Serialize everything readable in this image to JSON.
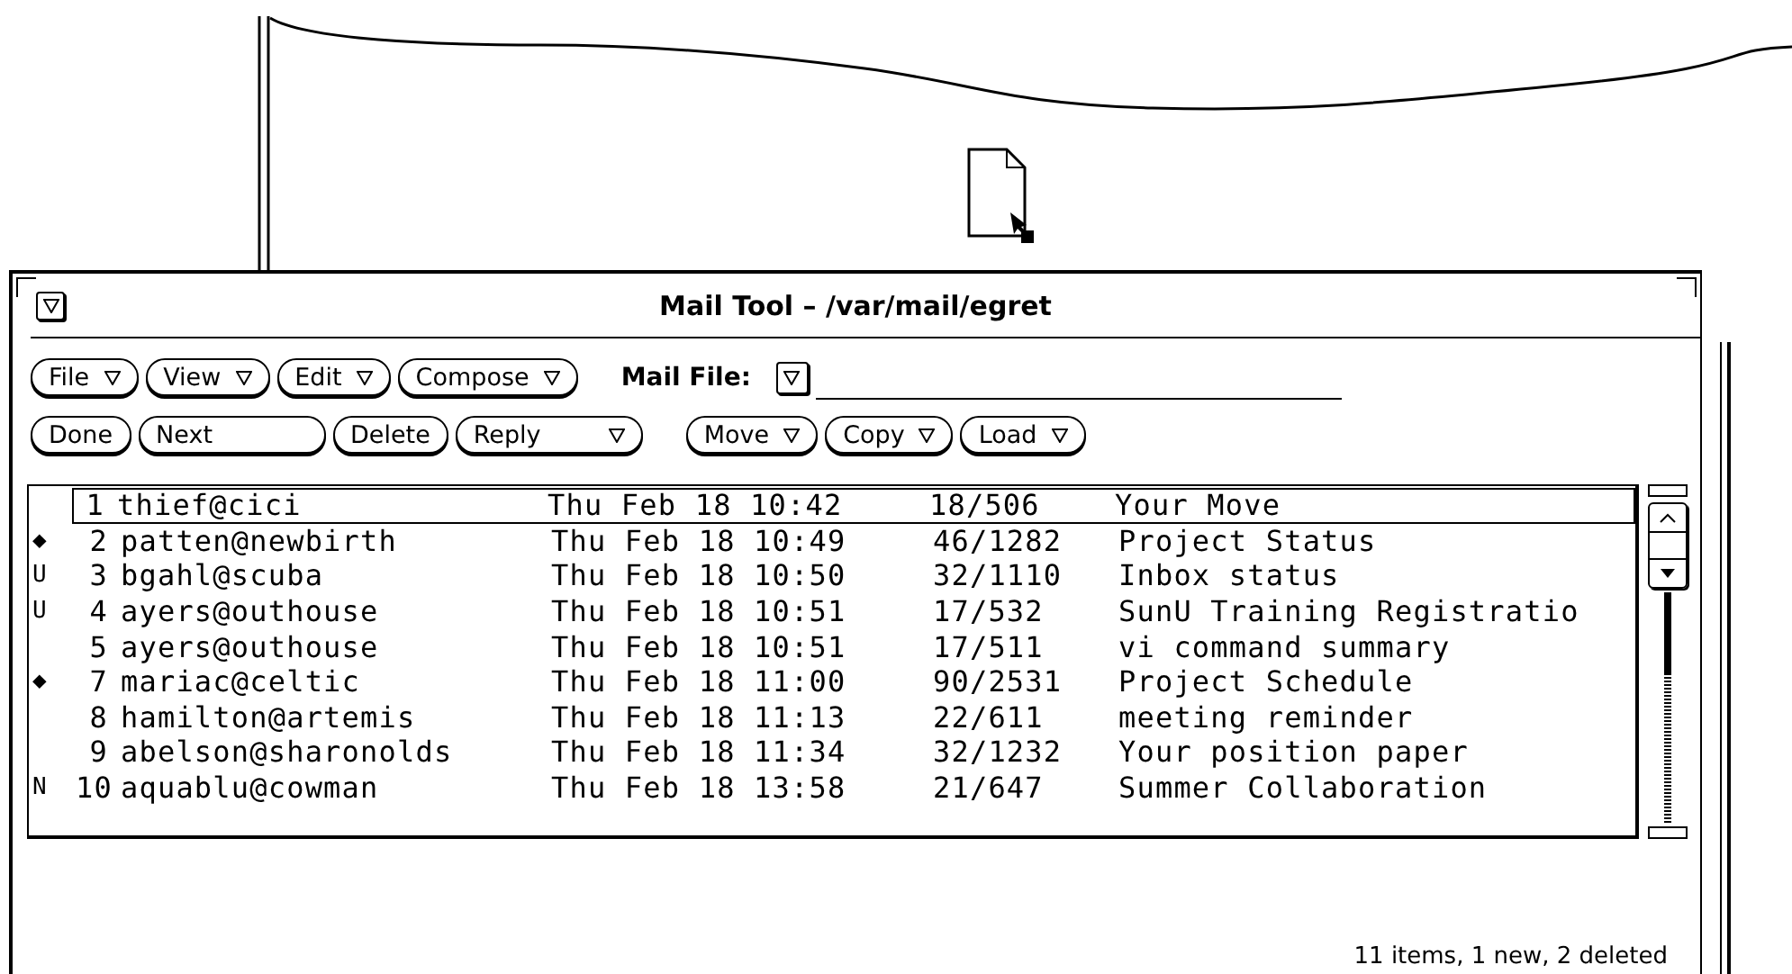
{
  "window": {
    "title": "Mail Tool  – /var/mail/egret"
  },
  "menu_buttons": [
    {
      "label": "File",
      "has_menu": true
    },
    {
      "label": "View",
      "has_menu": true
    },
    {
      "label": "Edit",
      "has_menu": true
    },
    {
      "label": "Compose",
      "has_menu": true
    }
  ],
  "mail_file": {
    "label": "Mail File:"
  },
  "action_buttons": [
    {
      "label": "Done",
      "has_menu": false,
      "wide": false
    },
    {
      "label": "Next",
      "has_menu": false,
      "wide": true
    },
    {
      "label": "Delete",
      "has_menu": false,
      "wide": false
    },
    {
      "label": "Reply",
      "has_menu": true,
      "wide": true
    }
  ],
  "file_buttons": [
    {
      "label": "Move",
      "has_menu": true
    },
    {
      "label": "Copy",
      "has_menu": true
    },
    {
      "label": "Load",
      "has_menu": true
    }
  ],
  "messages": [
    {
      "number": "1",
      "sender": "thief@cici",
      "date": "Thu Feb 18 10:42",
      "size": "18/506",
      "subject": "Your Move",
      "selected": true
    },
    {
      "flag": "◆",
      "number": "2",
      "sender": "patten@newbirth",
      "date": "Thu Feb 18 10:49",
      "size": "46/1282",
      "subject": "Project Status",
      "selected": false
    },
    {
      "flag": "U",
      "number": "3",
      "sender": "bgahl@scuba",
      "date": "Thu Feb 18 10:50",
      "size": "32/1110",
      "subject": "Inbox status",
      "selected": false
    },
    {
      "flag": "U",
      "number": "4",
      "sender": "ayers@outhouse",
      "date": "Thu Feb 18 10:51",
      "size": "17/532",
      "subject": "SunU Training Registratio",
      "selected": false
    },
    {
      "number": "5",
      "sender": "ayers@outhouse",
      "date": "Thu Feb 18 10:51",
      "size": "17/511",
      "subject": "vi command summary",
      "selected": false
    },
    {
      "flag": "◆",
      "number": "7",
      "sender": "mariac@celtic",
      "date": "Thu Feb 18 11:00",
      "size": "90/2531",
      "subject": "Project Schedule",
      "selected": false
    },
    {
      "number": "8",
      "sender": "hamilton@artemis",
      "date": "Thu Feb 18 11:13",
      "size": "22/611",
      "subject": "meeting reminder",
      "selected": false
    },
    {
      "number": "9",
      "sender": "abelson@sharonolds",
      "date": "Thu Feb 18 11:34",
      "size": "32/1232",
      "subject": "Your position paper",
      "selected": false
    },
    {
      "flag": "N",
      "number": "10",
      "sender": "aquablu@cowman",
      "date": "Thu Feb 18 13:58",
      "size": "21/647",
      "subject": "Summer Collaboration",
      "selected": false
    }
  ],
  "status_bar": "11 items, 1 new, 2 deleted"
}
